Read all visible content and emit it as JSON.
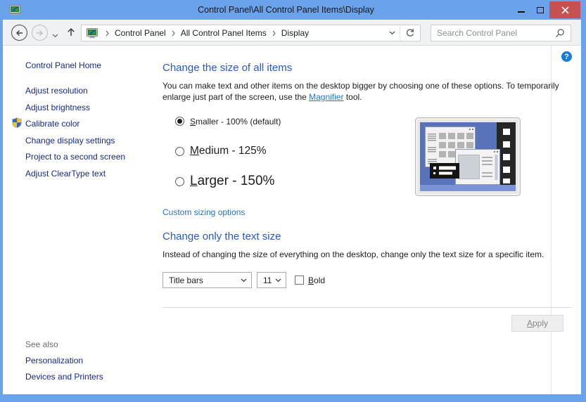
{
  "window": {
    "title": "Control Panel\\All Control Panel Items\\Display"
  },
  "toolbar": {
    "breadcrumb": [
      "Control Panel",
      "All Control Panel Items",
      "Display"
    ],
    "search_placeholder": "Search Control Panel"
  },
  "sidebar": {
    "home": "Control Panel Home",
    "tasks": [
      "Adjust resolution",
      "Adjust brightness",
      "Calibrate color",
      "Change display settings",
      "Project to a second screen",
      "Adjust ClearType text"
    ],
    "see_also_header": "See also",
    "see_also_links": [
      "Personalization",
      "Devices and Printers"
    ]
  },
  "main": {
    "help_label": "?",
    "size_section": {
      "heading": "Change the size of all items",
      "desc_line1": "You can make text and other items on the desktop bigger by choosing one of these options. To temporarily",
      "desc_line2_pre": "enlarge just part of the screen, use the ",
      "magnifier_link": "Magnifier",
      "desc_line2_post": " tool.",
      "options": [
        {
          "accel": "S",
          "rest": "maller - 100% (default)",
          "selected": true
        },
        {
          "accel": "M",
          "rest": "edium - 125%",
          "selected": false
        },
        {
          "accel": "L",
          "rest": "arger - 150%",
          "selected": false
        }
      ],
      "custom_link": "Custom sizing options"
    },
    "text_section": {
      "heading": "Change only the text size",
      "desc": "Instead of changing the size of everything on the desktop, change only the text size for a specific item.",
      "item_dropdown_value": "Title bars",
      "size_dropdown_value": "11",
      "bold_accel": "B",
      "bold_rest": "old",
      "bold_checked": false
    },
    "apply": {
      "accel": "A",
      "rest": "pply",
      "enabled": false
    }
  },
  "colors": {
    "titlebar_blue": "#6aa2ec",
    "close_button_red": "#c75050",
    "heading_blue": "#2859c4",
    "link_blue": "#2672cb",
    "sidebar_link_navy": "#142a8c",
    "help_icon_blue": "#1c7bd4"
  }
}
